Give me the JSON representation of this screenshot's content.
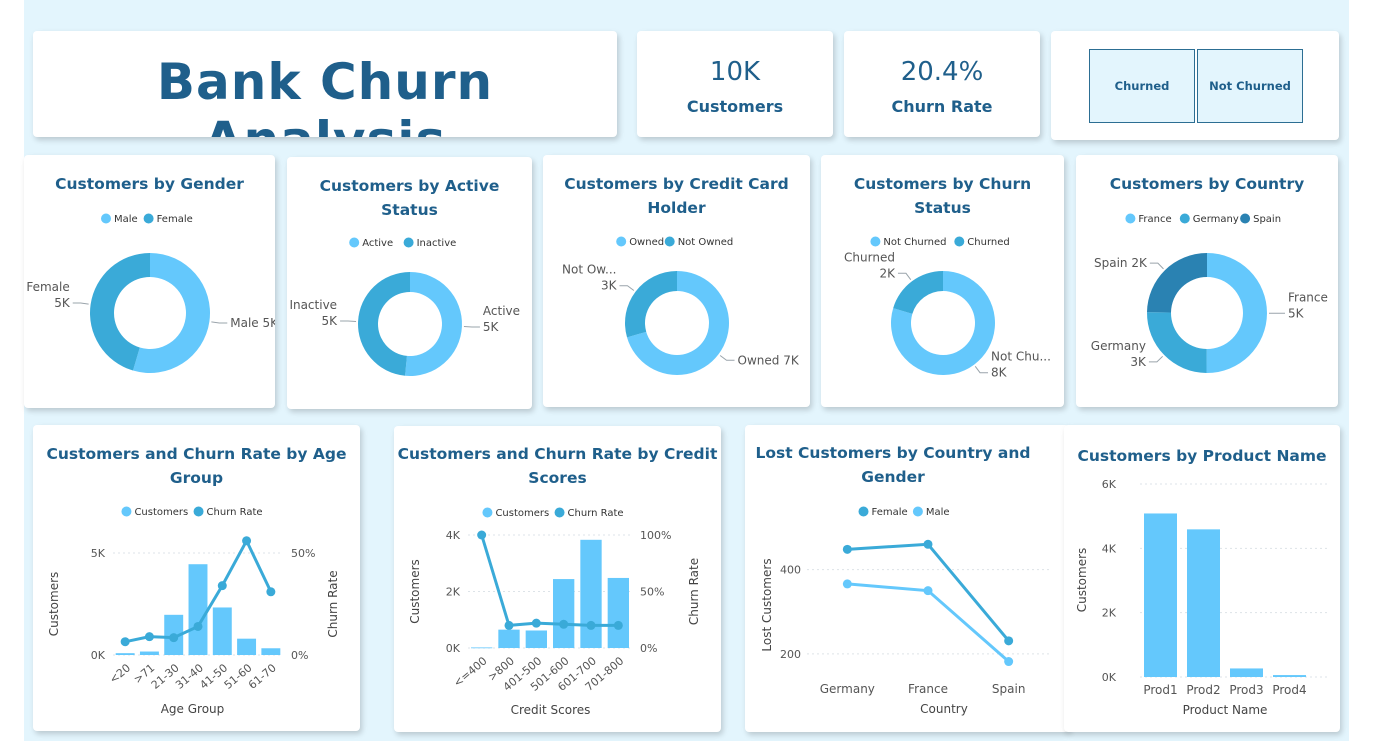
{
  "header": {
    "title": "Bank Churn Analysis"
  },
  "kpis": [
    {
      "value": "10K",
      "label": "Customers"
    },
    {
      "value": "20.4%",
      "label": "Churn Rate"
    }
  ],
  "slicer": {
    "options": [
      "Churned",
      "Not Churned"
    ]
  },
  "colors": {
    "light": "#64c8fc",
    "mid": "#3aaad8",
    "dark": "#2a82b2",
    "title": "#1f5f8b",
    "axis": "#555555",
    "canvas": "#e3f5fd"
  },
  "chart_data": [
    {
      "type": "pie",
      "title": [
        "Customers by Gender"
      ],
      "legend": [
        "Male",
        "Female"
      ],
      "slices": [
        {
          "name": "Male",
          "value": 5457,
          "label_lines": [
            "Male 5K"
          ]
        },
        {
          "name": "Female",
          "value": 4543,
          "label_lines": [
            "Female",
            "5K"
          ]
        }
      ]
    },
    {
      "type": "pie",
      "title": [
        "Customers by Active",
        "Status"
      ],
      "legend": [
        "Active",
        "Inactive"
      ],
      "slices": [
        {
          "name": "Active",
          "value": 5151,
          "label_lines": [
            "Active",
            "5K"
          ]
        },
        {
          "name": "Inactive",
          "value": 4849,
          "label_lines": [
            "Inactive",
            "5K"
          ]
        }
      ]
    },
    {
      "type": "pie",
      "title": [
        "Customers by Credit Card",
        "Holder"
      ],
      "legend": [
        "Owned",
        "Not Owned"
      ],
      "slices": [
        {
          "name": "Owned",
          "value": 7055,
          "label_lines": [
            "Owned 7K"
          ]
        },
        {
          "name": "Not Owned",
          "value": 2945,
          "label_lines": [
            "Not Ow...",
            "3K"
          ]
        }
      ]
    },
    {
      "type": "pie",
      "title": [
        "Customers by Churn",
        "Status"
      ],
      "legend": [
        "Not Churned",
        "Churned"
      ],
      "slices": [
        {
          "name": "Not Churned",
          "value": 7963,
          "label_lines": [
            "Not Chu...",
            "8K"
          ]
        },
        {
          "name": "Churned",
          "value": 2037,
          "label_lines": [
            "Churned",
            "2K"
          ]
        }
      ]
    },
    {
      "type": "pie",
      "title": [
        "Customers by Country"
      ],
      "legend": [
        "France",
        "Germany",
        "Spain"
      ],
      "slices": [
        {
          "name": "France",
          "value": 5014,
          "label_lines": [
            "France",
            "5K"
          ]
        },
        {
          "name": "Germany",
          "value": 2509,
          "label_lines": [
            "Germany",
            "3K"
          ]
        },
        {
          "name": "Spain",
          "value": 2477,
          "label_lines": [
            "Spain 2K"
          ]
        }
      ]
    },
    {
      "type": "bar",
      "title": [
        "Customers and Churn Rate by Age",
        "Group"
      ],
      "legend": [
        "Customers",
        "Churn Rate"
      ],
      "xlabel": "Age Group",
      "ylabel": "Customers",
      "y2label": "Churn Rate",
      "categories": [
        "<20",
        ">71",
        "21-30",
        "31-40",
        "41-50",
        "51-60",
        "61-70"
      ],
      "ylim": [
        0,
        5000
      ],
      "yticks": [
        "0K",
        "5K"
      ],
      "y2lim": [
        0,
        50
      ],
      "y2ticks": [
        "0%",
        "50%"
      ],
      "series": [
        {
          "name": "Customers",
          "values": [
            90,
            170,
            1970,
            4450,
            2330,
            800,
            330
          ]
        },
        {
          "name": "Churn Rate",
          "values": [
            6.5,
            9,
            8.5,
            14,
            34,
            56,
            31
          ]
        }
      ]
    },
    {
      "type": "bar",
      "title": [
        "Customers and Churn Rate by Credit",
        "Scores"
      ],
      "legend": [
        "Customers",
        "Churn Rate"
      ],
      "xlabel": "Credit Scores",
      "ylabel": "Customers",
      "y2label": "Churn Rate",
      "categories": [
        "<=400",
        ">800",
        "401-500",
        "501-600",
        "601-700",
        "701-800"
      ],
      "ylim": [
        0,
        4000
      ],
      "yticks": [
        "0K",
        "2K",
        "4K"
      ],
      "y2lim": [
        0,
        100
      ],
      "y2ticks": [
        "0%",
        "50%",
        "100%"
      ],
      "series": [
        {
          "name": "Customers",
          "values": [
            20,
            650,
            620,
            2440,
            3830,
            2480
          ]
        },
        {
          "name": "Churn Rate",
          "values": [
            100,
            20,
            22,
            21,
            20,
            20
          ]
        }
      ]
    },
    {
      "type": "line",
      "title": [
        "Lost Customers by Country and",
        "Gender"
      ],
      "legend": [
        "Female",
        "Male"
      ],
      "xlabel": "Country",
      "ylabel": "Lost Customers",
      "categories": [
        "Germany",
        "France",
        "Spain"
      ],
      "ylim": [
        150,
        520
      ],
      "yticks": [
        200,
        400
      ],
      "series": [
        {
          "name": "Female",
          "values": [
            448,
            460,
            231
          ]
        },
        {
          "name": "Male",
          "values": [
            366,
            350,
            182
          ]
        }
      ]
    },
    {
      "type": "bar",
      "title": [
        "Customers by Product Name"
      ],
      "xlabel": "Product Name",
      "ylabel": "Customers",
      "categories": [
        "Prod1",
        "Prod2",
        "Prod3",
        "Prod4"
      ],
      "ylim": [
        0,
        6000
      ],
      "yticks": [
        "0K",
        "2K",
        "4K",
        "6K"
      ],
      "values": [
        5084,
        4590,
        266,
        60
      ]
    }
  ]
}
